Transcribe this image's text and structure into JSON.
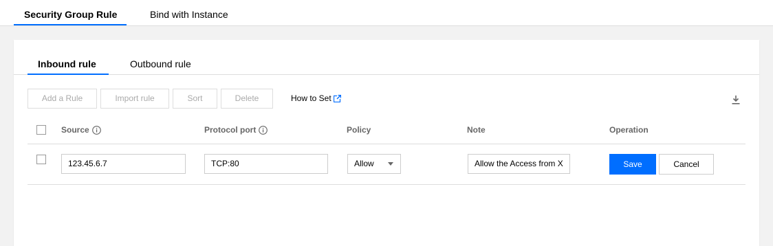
{
  "top_tabs": [
    {
      "label": "Security Group Rule",
      "active": true
    },
    {
      "label": "Bind with Instance",
      "active": false
    }
  ],
  "sub_tabs": [
    {
      "label": "Inbound rule",
      "active": true
    },
    {
      "label": "Outbound rule",
      "active": false
    }
  ],
  "toolbar": {
    "add_rule": "Add a Rule",
    "import_rule": "Import rule",
    "sort": "Sort",
    "delete": "Delete",
    "how_to_set": "How to Set",
    "download_icon": "download-icon"
  },
  "table": {
    "headers": {
      "source": "Source",
      "protocol_port": "Protocol port",
      "policy": "Policy",
      "note": "Note",
      "operation": "Operation"
    },
    "row": {
      "source": "123.45.6.7",
      "protocol_port": "TCP:80",
      "policy": "Allow",
      "note": "Allow the Access from X",
      "save": "Save",
      "cancel": "Cancel"
    }
  },
  "colors": {
    "accent": "#006eff",
    "background": "#f2f2f2",
    "border": "#dddddd"
  }
}
